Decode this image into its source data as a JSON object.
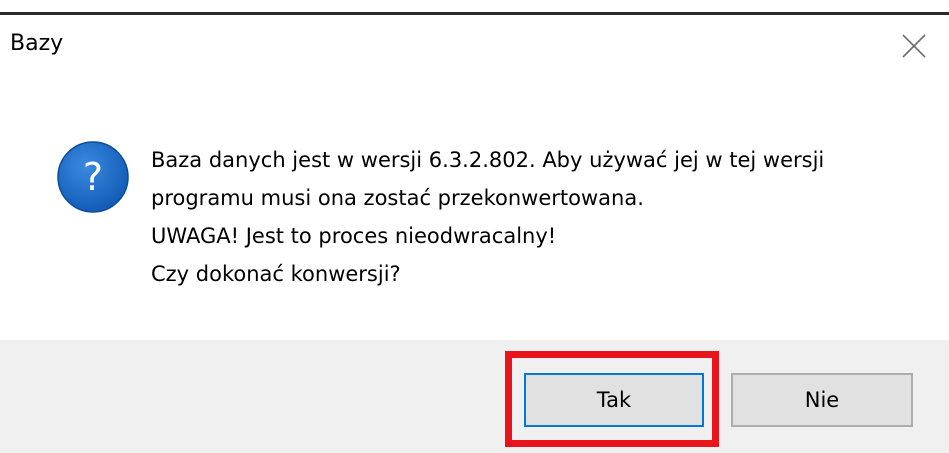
{
  "window": {
    "title": "Bazy",
    "close_icon": "close-icon"
  },
  "message": {
    "icon": "question-icon",
    "lines": [
      "Baza danych jest w wersji 6.3.2.802. Aby używać jej w tej wersji",
      "programu musi ona zostać przekonwertowana.",
      "UWAGA! Jest to proces nieodwracalny!",
      "Czy dokonać konwersji?"
    ]
  },
  "buttons": {
    "yes_label": "Tak",
    "no_label": "Nie"
  },
  "colors": {
    "icon_blue": "#1f6fc5",
    "highlight_red": "#e8131b",
    "focus_border": "#0078d7",
    "footer_bg": "#f0f0f0",
    "button_bg": "#e1e1e1"
  }
}
